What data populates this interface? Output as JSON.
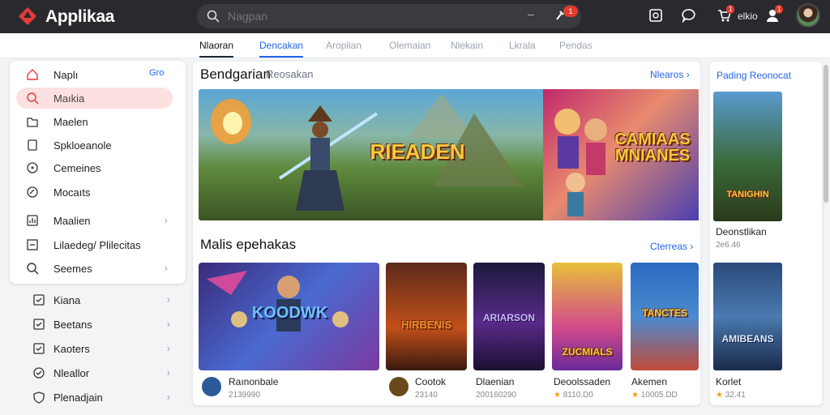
{
  "app": {
    "title": "Applikaa"
  },
  "search": {
    "placeholder": "Nagpan"
  },
  "topbar": {
    "notif_count": "1",
    "cart_count": "1",
    "chat_count": "1",
    "user_label": "elkio"
  },
  "tabs": [
    "Nlaoran",
    "Dencakan",
    "Aroplian",
    "Olemaian",
    "Nlekain",
    "Lkrala",
    "Pendas"
  ],
  "sidebar": {
    "more_label": "Gro",
    "top_items": [
      {
        "label": "Naplı",
        "icon": "home-icon"
      },
      {
        "label": "Maıkia",
        "icon": "search-icon",
        "active": true
      },
      {
        "label": "Maelen",
        "icon": "folder-icon"
      },
      {
        "label": "Spkloeanole",
        "icon": "bookmark-icon"
      },
      {
        "label": "Cemeines",
        "icon": "compass-icon"
      },
      {
        "label": "Mocaıts",
        "icon": "tag-icon"
      },
      {
        "label": "Maalien",
        "icon": "chart-icon",
        "chevron": true
      },
      {
        "label": "Lilaedeg/ Plilecitas",
        "icon": "list-icon"
      },
      {
        "label": "Seemes",
        "icon": "search-icon",
        "chevron": true
      }
    ],
    "bottom_items": [
      {
        "label": "Kiana",
        "icon": "check-box-icon"
      },
      {
        "label": "Beetans",
        "icon": "check-box-icon"
      },
      {
        "label": "Kaoters",
        "icon": "check-box-icon"
      },
      {
        "label": "Nleallor",
        "icon": "circle-check-icon"
      },
      {
        "label": "Plenadjain",
        "icon": "shield-icon"
      }
    ]
  },
  "featured": {
    "title": "Bendgarian",
    "subtitle": "Reosakan",
    "link": "Nlearos",
    "banners": [
      {
        "text": "RIEADEN"
      },
      {
        "text": "CAMIAAS MNIANES"
      }
    ]
  },
  "popular": {
    "title": "Malis epehakas",
    "link": "Cterreas",
    "games": [
      {
        "art_text": "KOODWK",
        "title": "Raınonbale",
        "meta": "2139990"
      },
      {
        "art_text": "HIRBENIS",
        "title": "Cootok",
        "meta": "23140"
      },
      {
        "art_text": "ARIARSON",
        "title": "Dlaenian",
        "meta": "200160290"
      },
      {
        "art_text": "ZUCMIALS",
        "title": "Deoolssaden",
        "meta": "8110.D0"
      },
      {
        "art_text": "TANCTES",
        "title": "Akemen",
        "meta": "10005.DD"
      }
    ]
  },
  "right_panel": {
    "title": "Pading Reonocat",
    "items": [
      {
        "art_text": "TANIGHIN",
        "title": "Deonstlikan",
        "meta": "2e6.46"
      },
      {
        "art_text": "AMIBEANS",
        "title": "Korlet",
        "meta": "32.41"
      }
    ]
  }
}
